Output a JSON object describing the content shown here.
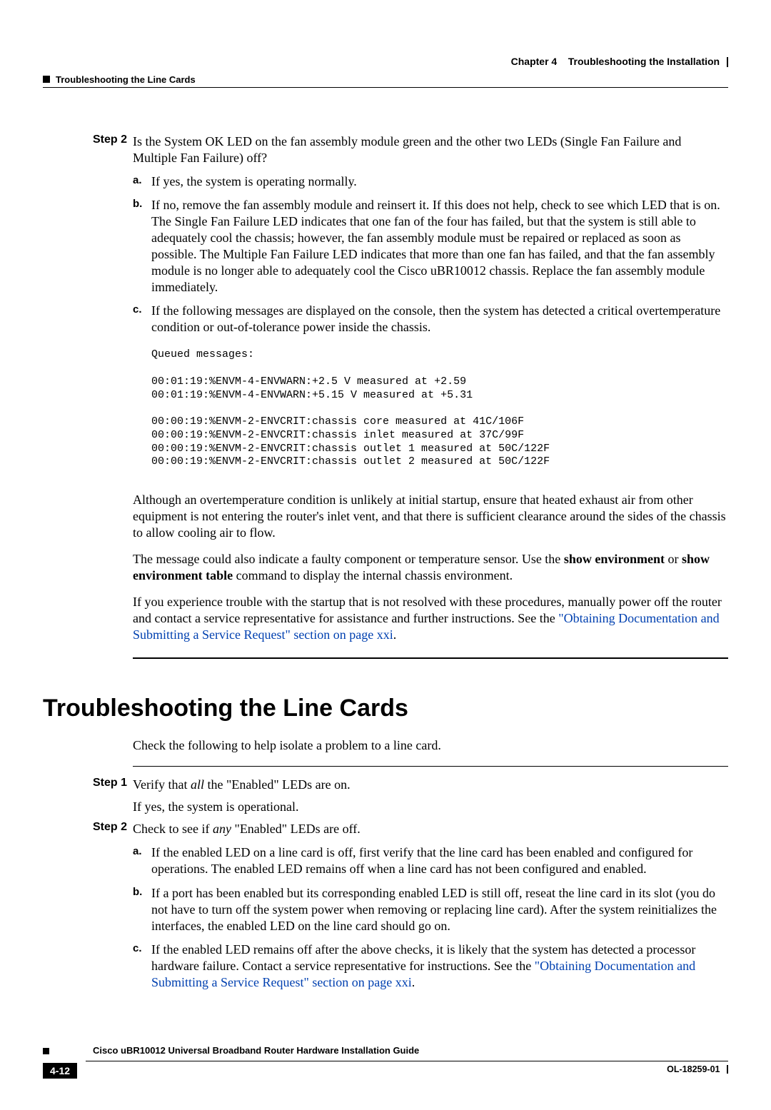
{
  "header": {
    "chapter_label": "Chapter 4",
    "chapter_title": "Troubleshooting the Installation",
    "section_title": "Troubleshooting the Line Cards"
  },
  "step2": {
    "label": "Step 2",
    "intro": "Is the System OK LED on the fan assembly module green and the other two LEDs (Single Fan Failure and Multiple Fan Failure) off?",
    "a_marker": "a.",
    "a": "If yes, the system is operating normally.",
    "b_marker": "b.",
    "b": "If no, remove the fan assembly module and reinsert it. If this does not help, check to see which LED that is on. The Single Fan Failure LED indicates that one fan of the four has failed, but that the system is still able to adequately cool the chassis; however, the fan assembly module must be repaired or replaced as soon as possible. The Multiple Fan Failure LED indicates that more than one fan has failed, and that the fan assembly module is no longer able to adequately cool the Cisco uBR10012 chassis. Replace the fan assembly module immediately.",
    "c_marker": "c.",
    "c": "If the following messages are displayed on the console, then the system has detected a critical overtemperature condition or out-of-tolerance power inside the chassis."
  },
  "code": {
    "l1": "Queued messages:",
    "l2": "",
    "l3": "00:01:19:%ENVM-4-ENVWARN:+2.5 V measured at +2.59",
    "l4": "00:01:19:%ENVM-4-ENVWARN:+5.15 V measured at +5.31",
    "l5": "",
    "l6": "00:00:19:%ENVM-2-ENVCRIT:chassis core measured at 41C/106F",
    "l7": "00:00:19:%ENVM-2-ENVCRIT:chassis inlet measured at 37C/99F",
    "l8": "00:00:19:%ENVM-2-ENVCRIT:chassis outlet 1 measured at 50C/122F",
    "l9": "00:00:19:%ENVM-2-ENVCRIT:chassis outlet 2 measured at 50C/122F"
  },
  "after_steps": {
    "p1": "Although an overtemperature condition is unlikely at initial startup, ensure that heated exhaust air from other equipment is not entering the router's inlet vent, and that there is sufficient clearance around the sides of the chassis to allow cooling air to flow.",
    "p2_a": "The message could also indicate a faulty component or temperature sensor. Use the ",
    "p2_b1": "show environment",
    "p2_c": " or ",
    "p2_b2": "show environment table",
    "p2_d": " command to display the internal chassis environment.",
    "p3_a": "If you experience trouble with the startup that is not resolved with these procedures, manually power off the router and contact a service representative for assistance and further instructions. See the ",
    "p3_link": "\"Obtaining Documentation and Submitting a Service Request\" section on page xxi",
    "p3_b": "."
  },
  "h1": "Troubleshooting the Line Cards",
  "intro2": "Check the following to help isolate a problem to a line card.",
  "s2_step1": {
    "label": "Step 1",
    "t1": "Verify that ",
    "em": "all",
    "t2": " the \"Enabled\" LEDs are on.",
    "p2": "If yes, the system is operational."
  },
  "s2_step2": {
    "label": "Step 2",
    "t1": "Check to see if ",
    "em": "any",
    "t2": " \"Enabled\" LEDs are off.",
    "a_marker": "a.",
    "a": "If the enabled LED on a line card is off, first verify that the line card has been enabled and configured for operations. The enabled LED remains off when a line card has not been configured and enabled.",
    "b_marker": "b.",
    "b": "If a port has been enabled but its corresponding enabled LED is still off, reseat the line card in its slot (you do not have to turn off the system power when removing or replacing line card). After the system reinitializes the interfaces, the enabled LED on the line card should go on.",
    "c_marker": "c.",
    "c_a": "If the enabled LED remains off after the above checks, it is likely that the system has detected a processor hardware failure. Contact a service representative for instructions. See the ",
    "c_link": "\"Obtaining Documentation and Submitting a Service Request\" section on page xxi",
    "c_b": "."
  },
  "footer": {
    "book_title": "Cisco uBR10012 Universal Broadband Router Hardware Installation Guide",
    "page_num": "4-12",
    "doc_id": "OL-18259-01"
  }
}
